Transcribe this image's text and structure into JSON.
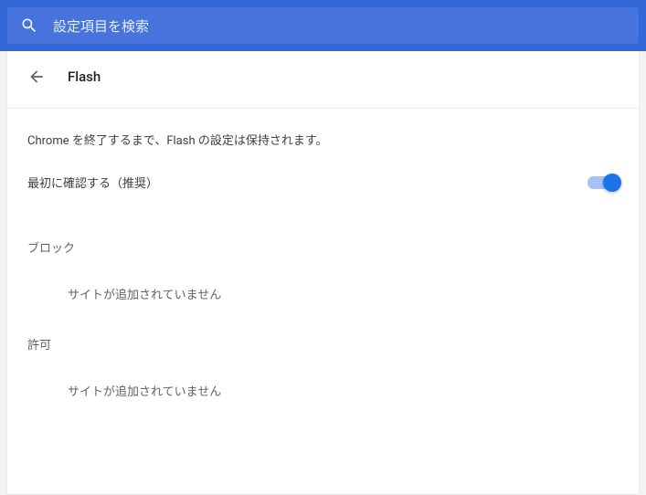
{
  "search": {
    "placeholder": "設定項目を検索"
  },
  "header": {
    "title": "Flash"
  },
  "info": "Chrome を終了するまで、Flash の設定は保持されます。",
  "toggle": {
    "label": "最初に確認する（推奨）",
    "state": "on"
  },
  "sections": {
    "block": {
      "title": "ブロック",
      "empty": "サイトが追加されていません"
    },
    "allow": {
      "title": "許可",
      "empty": "サイトが追加されていません"
    }
  },
  "colors": {
    "accent": "#1a73e8",
    "searchBar": "#3367d6"
  }
}
